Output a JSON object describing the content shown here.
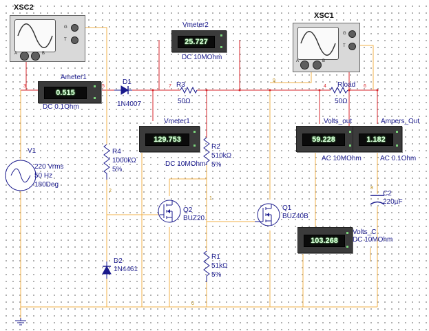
{
  "instruments": {
    "xsc2": {
      "name": "XSC2",
      "pin_g": "G",
      "pin_t": "T",
      "pin_a": "A",
      "pin_b": "B"
    },
    "xsc1": {
      "name": "XSC1",
      "pin_g": "G",
      "pin_t": "T",
      "pin_a": "A",
      "pin_b": "B"
    }
  },
  "meters": {
    "ameter1": {
      "name": "Ameter1",
      "value": "0.515",
      "mode": "DC  0.1Ohm"
    },
    "vmeter2": {
      "name": "Vmeter2",
      "value": "25.727",
      "mode": "DC  10MOhm"
    },
    "vmeter1": {
      "name": "Vmeter1",
      "value": "129.753",
      "mode": "DC  10MOhm"
    },
    "volts_out": {
      "name": "Volts_out",
      "value": "59.228",
      "mode": "AC  10MOhm"
    },
    "ampers_out": {
      "name": "Ampers_Out",
      "value": "1.182",
      "mode": "AC  0.1Ohm"
    },
    "volts_c": {
      "name": "Volts_C",
      "value": "103.268",
      "mode": "DC  10MOhm"
    }
  },
  "components": {
    "v1": {
      "name": "V1",
      "line1": "220 Vrms",
      "line2": "50 Hz",
      "line3": "180Deg"
    },
    "d1": {
      "name": "D1",
      "part": "1N4007"
    },
    "r3": {
      "name": "R3",
      "value": "50Ω"
    },
    "rload": {
      "name": "Rload",
      "value": "50Ω"
    },
    "r4": {
      "name": "R4",
      "value": "1000kΩ",
      "tol": "5%"
    },
    "r2": {
      "name": "R2",
      "value": "510kΩ",
      "tol": "5%"
    },
    "r1": {
      "name": "R1",
      "value": "51kΩ",
      "tol": "5%"
    },
    "q2": {
      "name": "Q2",
      "part": "BUZ20"
    },
    "q1": {
      "name": "Q1",
      "part": "BUZ40B"
    },
    "c2": {
      "name": "C2",
      "value": "220µF"
    },
    "d2": {
      "name": "D2",
      "part": "1N4461"
    }
  },
  "nodes": {
    "n3": "3",
    "n5": "5",
    "n7": "7",
    "n4": "4",
    "n6": "6",
    "n2": "2",
    "n1": "1",
    "n0": "0",
    "n8": "8",
    "n9": "9"
  },
  "colors": {
    "wire_red": "#d7262b",
    "wire_orange": "#f0b14a",
    "component_blue": "#1a1a8c",
    "meter_body": "#3b3b3b",
    "meter_text": "#dfffe0"
  }
}
